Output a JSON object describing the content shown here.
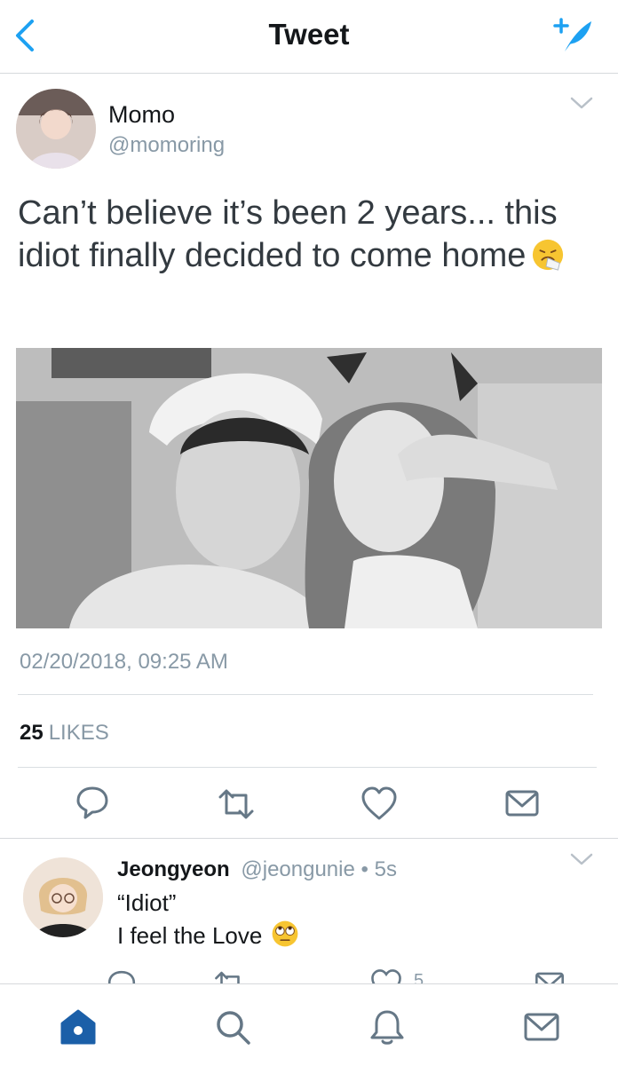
{
  "header": {
    "title": "Tweet"
  },
  "tweet": {
    "author_name": "Momo",
    "author_handle": "@momoring",
    "text_line1": "Can’t believe it’s been 2 years... this",
    "text_line2": "idiot finally decided to come home",
    "timestamp": "02/20/2018, 09:25 AM",
    "likes_count": "25",
    "likes_label": "LIKES"
  },
  "reply": {
    "name": "Jeongyeon",
    "handle": "@jeongunie",
    "separator": "•",
    "time": "5s",
    "line1": "“Idiot”",
    "line2": "I feel the Love",
    "like_count": "5"
  },
  "colors": {
    "accent": "#1da1f2",
    "nav_active": "#1b5fa8",
    "muted": "#8899a6"
  }
}
